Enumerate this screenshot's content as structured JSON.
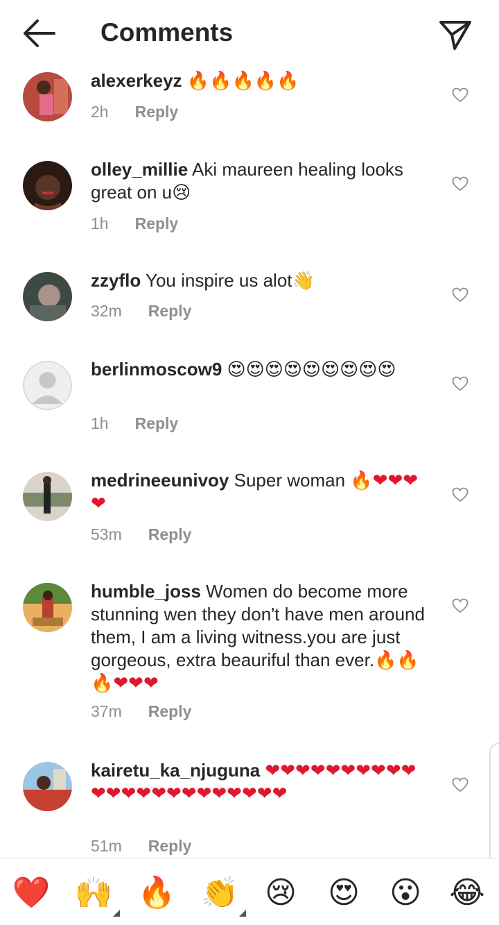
{
  "header": {
    "title": "Comments",
    "back_icon": "arrow-left-icon",
    "send_icon": "paper-plane-icon"
  },
  "reply_label": "Reply",
  "comments": [
    {
      "username": "alexerkeyz",
      "text": " 🔥🔥🔥🔥🔥",
      "time": "2h"
    },
    {
      "username": "olley_millie",
      "text": " Aki maureen healing looks great on u😢",
      "time": "1h"
    },
    {
      "username": "zzyflo",
      "text": " You inspire  us alot👋",
      "time": "32m"
    },
    {
      "username": "berlinmoscow9",
      "text": " 😍😍😍😍😍😍😍😍😍",
      "time": "1h"
    },
    {
      "username": "medrineeunivoy",
      "text": " Super woman 🔥❤❤❤❤",
      "time": "53m"
    },
    {
      "username": "humble_joss",
      "text": " Women do become more stunning wen they don't have men around them, I am a living witness.you are just gorgeous, extra beauriful than ever.🔥🔥🔥❤❤❤",
      "time": "37m"
    },
    {
      "username": "kairetu_ka_njuguna",
      "text": " ❤❤❤❤❤❤❤❤❤❤❤❤❤❤❤❤❤❤❤❤❤❤❤",
      "time": "51m"
    }
  ],
  "reactions": [
    "❤️",
    "🙌",
    "🔥",
    "👏",
    "😢",
    "😍",
    "😮",
    "😂"
  ],
  "colors": {
    "text": "#262626",
    "secondary": "#8e8e8e",
    "heart_red": "#e0182d"
  }
}
